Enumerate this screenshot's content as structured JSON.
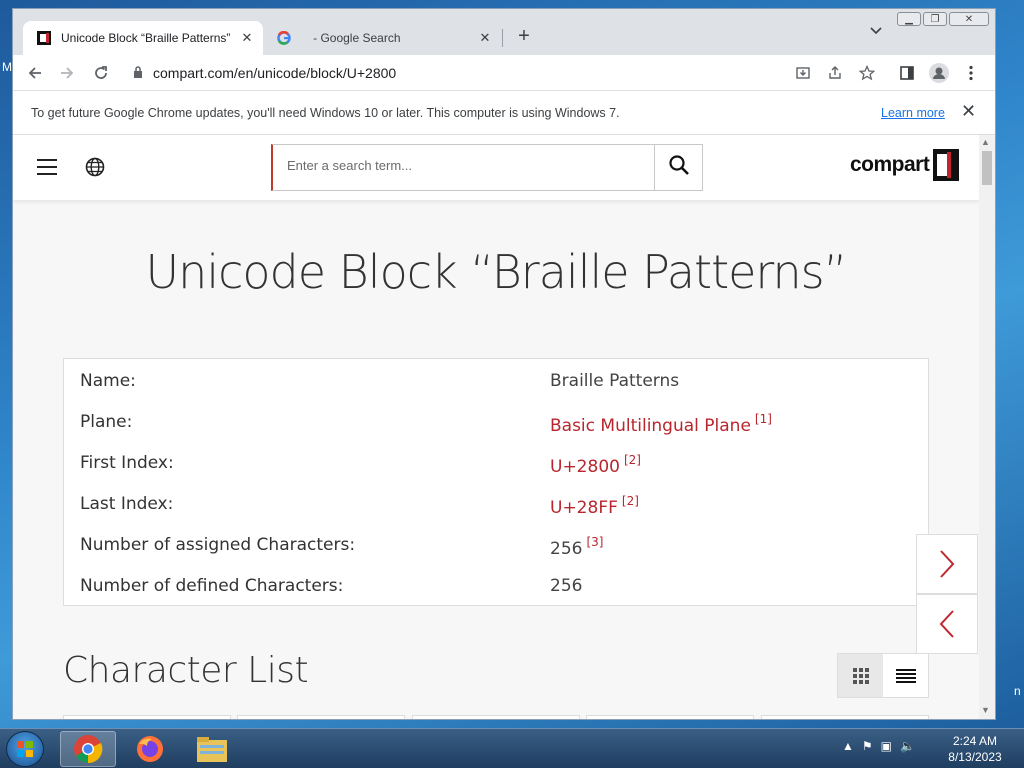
{
  "browser": {
    "tabs": [
      {
        "title": "Unicode Block “Braille Patterns”",
        "close": "✕"
      },
      {
        "title": "⠀ - Google Search",
        "close": "✕"
      }
    ],
    "new_tab": "+",
    "url": "compart.com/en/unicode/block/U+2800"
  },
  "infobar": {
    "message": "To get future Google Chrome updates, you'll need Windows 10 or later. This computer is using Windows 7.",
    "link": "Learn more",
    "close": "✕"
  },
  "site": {
    "search_placeholder": "Enter a search term...",
    "logo_text": "compart",
    "heading": "Unicode Block “Braille Patterns”",
    "info_rows": [
      {
        "key": "Name:",
        "value": "Braille Patterns",
        "sup": ""
      },
      {
        "key": "Plane:",
        "value": "Basic Multilingual Plane",
        "sup": "[1]"
      },
      {
        "key": "First Index:",
        "value": "U+2800",
        "sup": "[2]"
      },
      {
        "key": "Last Index:",
        "value": "U+28FF",
        "sup": "[2]"
      },
      {
        "key": "Number of assigned Characters:",
        "value": "256",
        "sup": "[3]"
      },
      {
        "key": "Number of defined Characters:",
        "value": "256",
        "sup": ""
      }
    ],
    "next_arrow": "›",
    "prev_arrow": "‹",
    "section_heading": "Character List"
  },
  "taskbar": {
    "time": "2:24 AM",
    "date": "8/13/2023"
  },
  "desktop_letters": {
    "left": "M",
    "right": "n"
  },
  "colors": {
    "accent_red": "#c0262e",
    "link_red": "#b8262e",
    "chrome_blue": "#1a73e8"
  }
}
